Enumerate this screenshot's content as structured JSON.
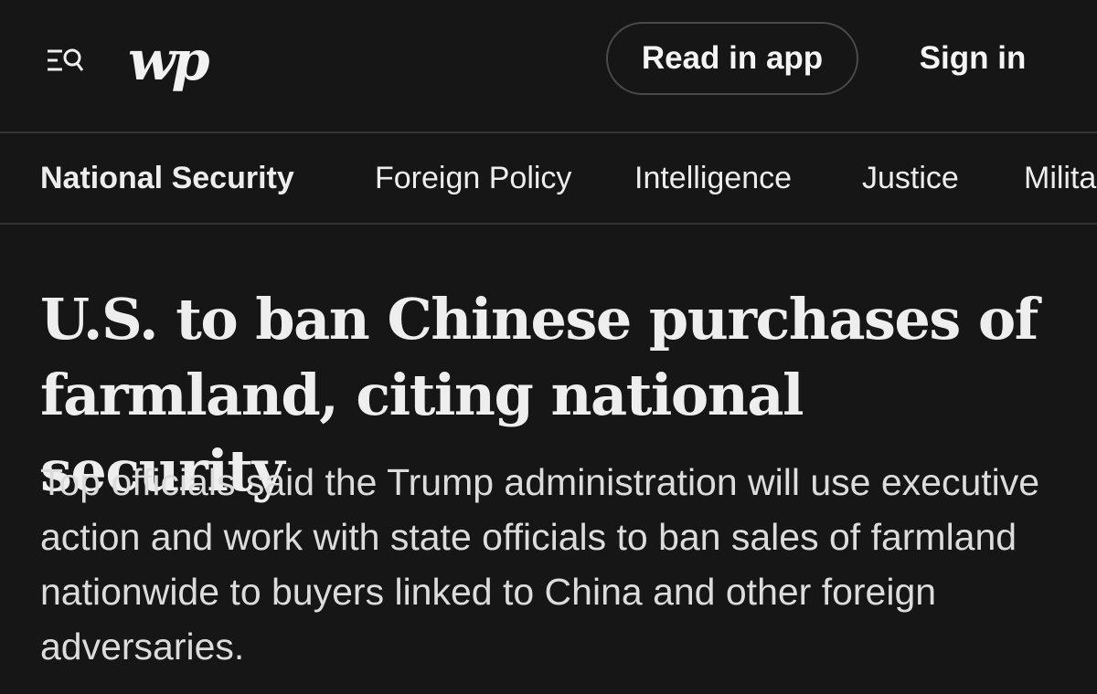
{
  "header": {
    "logo_text": "wp",
    "icons": [
      "menu-search-icon"
    ],
    "read_in_app_label": "Read in app",
    "sign_in_label": "Sign in"
  },
  "subnav": {
    "items": [
      {
        "label": "National Security",
        "active": true
      },
      {
        "label": "Foreign Policy",
        "active": false
      },
      {
        "label": "Intelligence",
        "active": false
      },
      {
        "label": "Justice",
        "active": false
      },
      {
        "label": "Military",
        "active": false
      }
    ]
  },
  "article": {
    "headline": "U.S. to ban Chinese purchases of farmland, citing national security",
    "dek": "Top officials said the Trump administration will use executive action and work with state officials to ban sales of farmland nationwide to buyers linked to China and other foreign adversaries."
  },
  "colors": {
    "background": "#161616",
    "text": "#efefef",
    "divider": "#333333"
  }
}
